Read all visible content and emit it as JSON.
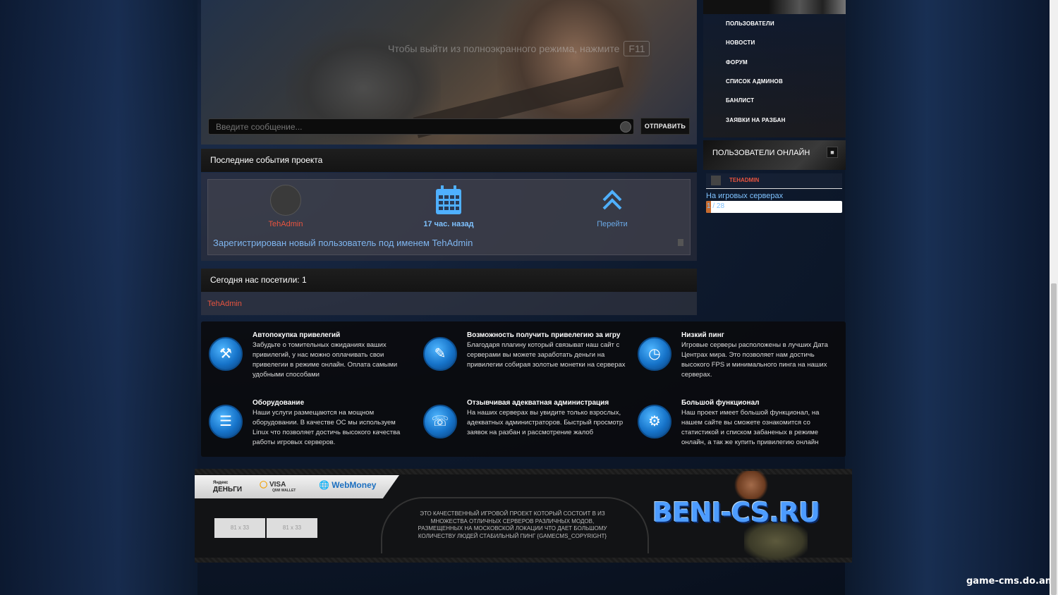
{
  "chat": {
    "fullscreen_hint": "Чтобы выйти из полноэкранного режима, нажмите",
    "fullscreen_key": "F11",
    "input_placeholder": "Введите сообщение...",
    "send_label": "ОТПРАВИТЬ"
  },
  "sidebar": {
    "menu": [
      {
        "label": "ПОЛЬЗОВАТЕЛИ"
      },
      {
        "label": "НОВОСТИ"
      },
      {
        "label": "ФОРУМ"
      },
      {
        "label": "СПИСОК АДМИНОВ"
      },
      {
        "label": "БАНЛИСТ"
      },
      {
        "label": "ЗАЯВКИ НА РАЗБАН"
      }
    ],
    "online_title": "ПОЛЬЗОВАТЕЛИ ОНЛАЙН",
    "online_users": [
      {
        "name": "TEHADMIN"
      }
    ],
    "servers_label": "На игровых серверах",
    "servers_count": "1 / 28",
    "servers_fill_fraction": 0.036
  },
  "events": {
    "title": "Последние события проекта",
    "user": "TehAdmin",
    "time": "17 час. назад",
    "go_label": "Перейти",
    "text": "Зарегистрирован новый пользователь под именем TehAdmin"
  },
  "visitors": {
    "title": "Сегодня нас посетили: 1",
    "names": [
      "TehAdmin"
    ]
  },
  "features": [
    {
      "icon": "tools-icon",
      "title": "Автопокупка привелегий",
      "text": "Забудьте о томительных ожиданиях ваших привилегий, у нас можно оплачивать свои привелегии в режиме онлайн. Оплата самыми удобными способами"
    },
    {
      "icon": "wallet-icon",
      "title": "Возможность получить привелегию за игру",
      "text": "Благодаря плагину который связыват наш сайт с серверами вы можете заработать деньги на привилегии собирая золотые монетки на серверах"
    },
    {
      "icon": "speed-icon",
      "title": "Низкий пинг",
      "text": "Игровые серверы расположены в лучших Дата Центрах мира. Это позволяет нам достичь высокого FPS и минимального пинга на наших серверах."
    },
    {
      "icon": "server-icon",
      "title": "Оборудование",
      "text": "Наши услуги размещаются на мощном оборудовании. В качестве ОС мы используем Linux что позволяет достичь высокого качества работы игровых серверов."
    },
    {
      "icon": "support-icon",
      "title": "Отзывчивая адекватная администрация",
      "text": "На наших серверах вы увидите только взрослых, адекватных администраторов. Быстрый просмотр заявок на разбан и рассмотрение жалоб"
    },
    {
      "icon": "gears-icon",
      "title": "Большой функционал",
      "text": "Наш проект имеет большой функционал, на нашем сайте вы сможете ознакомится со статистикой и списком забаненых в режиме онлайн, а так же купить привилегию онлайн"
    }
  ],
  "footer": {
    "payments": {
      "yandex_line1": "Яндекс",
      "yandex_line2": "ДЕНЬГИ",
      "qiwi": "VISA",
      "qiwi_sub": "QIWI WALLET",
      "webmoney": "WebMoney"
    },
    "banners": [
      "81 x 33",
      "81 x 33"
    ],
    "text": "ЭТО КАЧЕСТВЕННЫЙ ИГРОВОЙ ПРОЕКТ КОТОРЫЙ СОСТОИТ В ИЗ МНОЖЕСТВА ОТЛИЧНЫХ СЕРВЕРОВ РАЗЛИЧНЫХ МОДОВ, РАЗМЕЩЕННЫХ НА МОСКОВСКОЙ ЛОКАЦИИ ЧТО ДАЕТ БОЛЬШОМУ КОЛИЧЕСТВУ ЛЮДЕЙ СТАБИЛЬНЫЙ ПИНГ {GAMECMS_COPYRIGHT}",
    "logo": "BENI-CS.RU"
  },
  "watermark": "game-cms.do.am",
  "colors": {
    "accent_blue": "#7fc2ff",
    "user_red": "#e8543f",
    "icon_blue": "#1673c9"
  }
}
